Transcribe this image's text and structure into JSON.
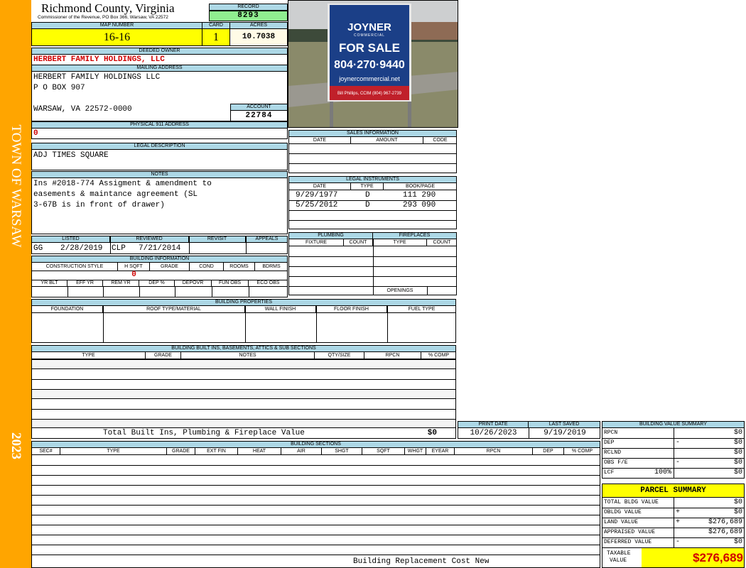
{
  "sidebar": {
    "town": "TOWN OF WARSAW",
    "year": "2023"
  },
  "header": {
    "county": "Richmond County, Virginia",
    "commissioner": "Commissioner of the Revenue, PO Box 366, Warsaw, VA 22572"
  },
  "record": {
    "label": "RECORD",
    "value": "8293"
  },
  "map": {
    "label": "MAP NUMBER",
    "value": "16-16"
  },
  "card": {
    "label": "CARD",
    "value": "1"
  },
  "acres": {
    "label": "ACRES",
    "value": "10.7038"
  },
  "owner": {
    "label": "DEEDED OWNER",
    "value": "HERBERT FAMILY HOLDINGS, LLC"
  },
  "mailing": {
    "label": "MAILING ADDRESS",
    "line1": "HERBERT FAMILY HOLDINGS LLC",
    "line2": "P O BOX 907",
    "line3": "WARSAW, VA 22572-0000"
  },
  "account": {
    "label": "ACCOUNT",
    "value": "22784"
  },
  "physical": {
    "label": "PHYSICAL 911 ADDRESS",
    "value": "0"
  },
  "legal": {
    "label": "LEGAL DESCRIPTION",
    "value": "ADJ TIMES SQUARE"
  },
  "notes": {
    "label": "NOTES",
    "line1": "Ins #2018-774 Assigment & amendment to",
    "line2": "easements & maintance agreement (SL",
    "line3": "3-67B is in front of drawer)"
  },
  "photo": {
    "brand": "JOYNER",
    "brand_sub": "COMMERCIAL",
    "for_sale": "FOR SALE",
    "phone": "804·270·9440",
    "web": "joynercommercial.net",
    "agent": "Bill Phillips, CCIM (804) 967-2739"
  },
  "sales": {
    "label": "SALES INFORMATION",
    "cols": [
      "DATE",
      "AMOUNT",
      "CODE"
    ]
  },
  "instruments": {
    "label": "LEGAL INSTRUMENTS",
    "cols": [
      "DATE",
      "TYPE",
      "BOOK/PAGE"
    ],
    "rows": [
      {
        "date": "9/29/1977",
        "type": "D",
        "book": "111 290"
      },
      {
        "date": "5/25/2012",
        "type": "D",
        "book": "293 090"
      }
    ]
  },
  "status": {
    "listed_label": "LISTED",
    "listed_by": "GG",
    "listed_date": "2/28/2019",
    "reviewed_label": "REVIEWED",
    "reviewed_by": "CLP",
    "reviewed_date": "7/21/2014",
    "revisit_label": "REVISIT",
    "appeals_label": "APPEALS"
  },
  "building_info": {
    "label": "BUILDING INFORMATION",
    "cols1": [
      "CONSTRUCTION STYLE",
      "H SQFT",
      "GRADE",
      "COND",
      "ROOMS",
      "BDRMS"
    ],
    "hsqft": "0",
    "cols2": [
      "YR BLT",
      "EFF YR",
      "REM YR",
      "DEP %",
      "DEPOVR",
      "FUN OBS",
      "ECO OBS"
    ]
  },
  "plumbing": {
    "label": "PLUMBING",
    "cols": [
      "FIXTURE",
      "COUNT"
    ]
  },
  "fireplaces": {
    "label": "FIREPLACES",
    "cols": [
      "TYPE",
      "COUNT"
    ],
    "openings": "OPENINGS"
  },
  "properties": {
    "label": "BUILDING PROPERTIES",
    "cols": [
      "FOUNDATION",
      "ROOF TYPE/MATERIAL",
      "WALL FINISH",
      "FLOOR FINISH",
      "FUEL TYPE"
    ]
  },
  "builtins": {
    "label": "BUILDING BUILT INS, BASEMENTS, ATTICS & SUB SECTIONS",
    "cols": [
      "TYPE",
      "GRADE",
      "NOTES",
      "QTY/SIZE",
      "RPCN",
      "% COMP"
    ],
    "total_label": "Total Built Ins, Plumbing & Fireplace Value",
    "total_value": "$0"
  },
  "dates": {
    "print_label": "PRINT DATE",
    "print": "10/26/2023",
    "saved_label": "LAST SAVED",
    "saved": "9/19/2019"
  },
  "sections": {
    "label": "BUILDING SECTIONS",
    "cols": [
      "SEC#",
      "TYPE",
      "GRADE",
      "EXT FIN",
      "HEAT",
      "AIR",
      "SHGT",
      "SQFT",
      "WHGT",
      "EYEAR",
      "RPCN",
      "DEP",
      "% COMP"
    ],
    "footer": "Building Replacement Cost New"
  },
  "bvs": {
    "label": "BUILDING VALUE SUMMARY",
    "rows": [
      {
        "label": "RPCN",
        "sign": "",
        "value": "$0"
      },
      {
        "label": "DEP",
        "sign": "-",
        "value": "$0"
      },
      {
        "label": "RCLND",
        "sign": "",
        "value": "$0"
      },
      {
        "label": "OBS F/E",
        "sign": "-",
        "value": "$0"
      },
      {
        "label": "LCF",
        "pct": "100%",
        "sign": "",
        "value": "$0"
      }
    ]
  },
  "parcel": {
    "label": "PARCEL SUMMARY",
    "rows": [
      {
        "label": "TOTAL BLDG VALUE",
        "sign": "",
        "value": "$0"
      },
      {
        "label": "OBLDG VALUE",
        "sign": "+",
        "value": "$0"
      },
      {
        "label": "LAND VALUE",
        "sign": "+",
        "value": "$276,689"
      },
      {
        "label": "APPRAISED VALUE",
        "sign": "",
        "value": "$276,689"
      },
      {
        "label": "DEFERRED VALUE",
        "sign": "-",
        "value": "$0"
      }
    ],
    "taxable_label1": "TAXABLE",
    "taxable_label2": "VALUE",
    "taxable_value": "$276,689"
  },
  "colors": {
    "sidebar": "#ffa500",
    "header_blue": "#add8e6",
    "highlight_yellow": "#ffff00",
    "record_green": "#90ee90",
    "accent_red": "#d00000"
  }
}
